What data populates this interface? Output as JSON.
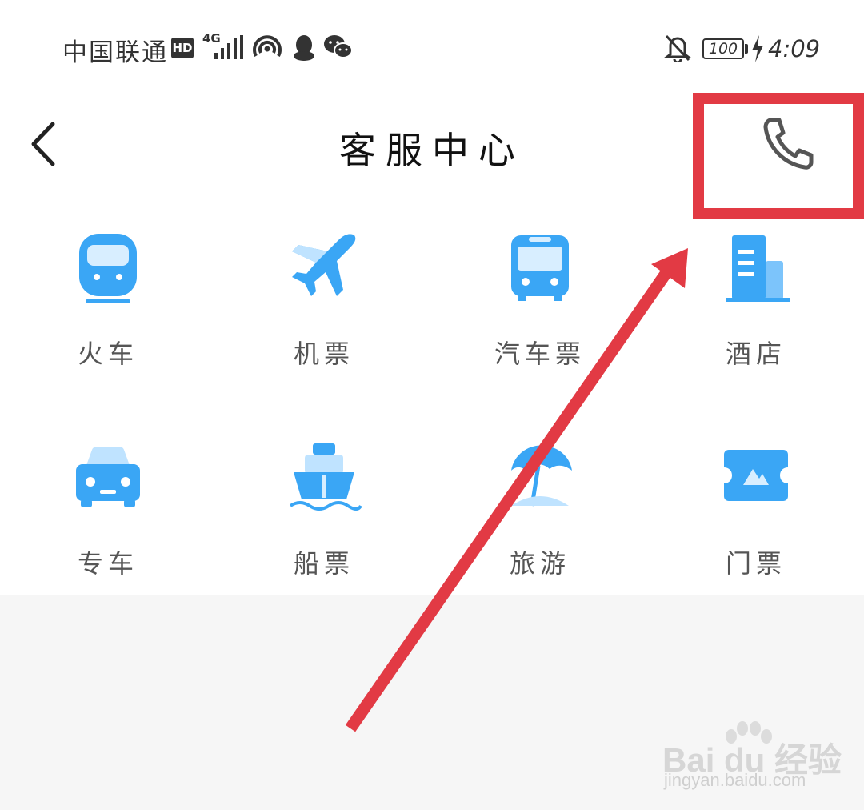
{
  "status_bar": {
    "carrier": "中国联通",
    "hd_badge": "HD",
    "network_type": "4G",
    "battery": "100",
    "time": "4:09",
    "icons": [
      "hd-icon",
      "signal-icon",
      "hotspot-icon",
      "qq-icon",
      "wechat-icon",
      "bell-off-icon",
      "battery-icon",
      "charging-icon"
    ]
  },
  "header": {
    "title": "客服中心",
    "back_icon": "chevron-left-icon",
    "phone_icon": "phone-icon"
  },
  "services": [
    {
      "label": "火车",
      "icon": "train-icon"
    },
    {
      "label": "机票",
      "icon": "plane-icon"
    },
    {
      "label": "汽车票",
      "icon": "bus-icon"
    },
    {
      "label": "酒店",
      "icon": "hotel-icon"
    },
    {
      "label": "专车",
      "icon": "car-icon"
    },
    {
      "label": "船票",
      "icon": "ship-icon"
    },
    {
      "label": "旅游",
      "icon": "beach-umbrella-icon"
    },
    {
      "label": "门票",
      "icon": "ticket-icon"
    }
  ],
  "colors": {
    "icon_blue": "#3aa6f5",
    "icon_blue_light": "#bfe3ff",
    "annotation_red": "#e23a44",
    "bottom_background": "#f6f6f6"
  },
  "watermark": {
    "brand": "Bai du 经验",
    "url": "jingyan.baidu.com"
  }
}
